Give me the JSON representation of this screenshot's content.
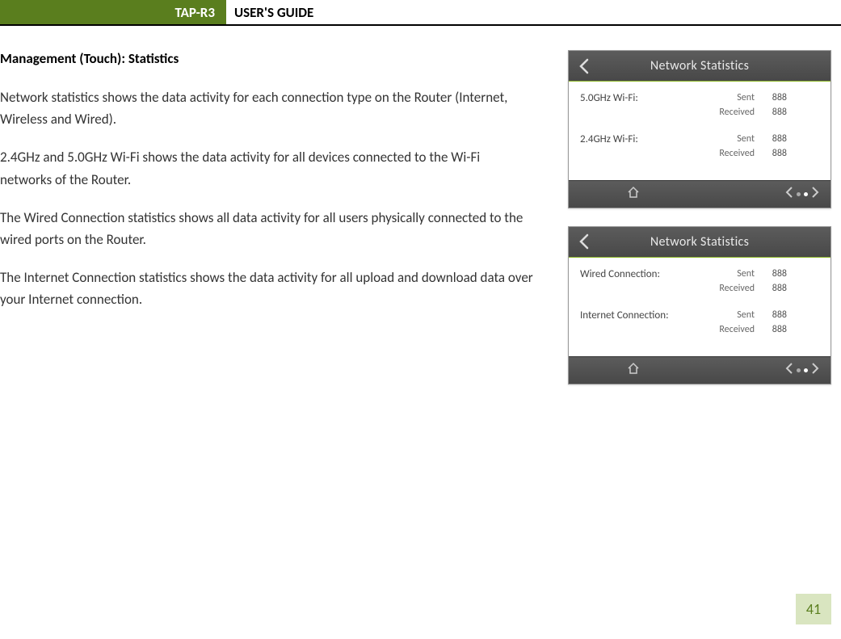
{
  "header": {
    "product": "TAP-R3",
    "guide": "USER'S GUIDE"
  },
  "section_title": "Management (Touch): Statistics",
  "paragraphs": {
    "p1": "Network statistics shows the data activity for each connection type on the Router (Internet, Wireless and Wired).",
    "p2": "2.4GHz and 5.0GHz Wi-Fi shows the data activity for all devices connected to the Wi-Fi networks of the Router.",
    "p3": "The Wired Connection statistics shows all data activity for all users physically connected to the wired ports on the Router.",
    "p4": "The Internet Connection statistics shows the data activity for all upload and download data over your Internet connection."
  },
  "screens": {
    "s1": {
      "title": "Network Statistics",
      "rows": {
        "r1": {
          "label": "5.0GHz Wi-Fi:",
          "sent_key": "Sent",
          "sent_val": "888",
          "recv_key": "Received",
          "recv_val": "888"
        },
        "r2": {
          "label": "2.4GHz Wi-Fi:",
          "sent_key": "Sent",
          "sent_val": "888",
          "recv_key": "Received",
          "recv_val": "888"
        }
      }
    },
    "s2": {
      "title": "Network Statistics",
      "rows": {
        "r1": {
          "label": "Wired Connection:",
          "sent_key": "Sent",
          "sent_val": "888",
          "recv_key": "Received",
          "recv_val": "888"
        },
        "r2": {
          "label": "Internet Connection:",
          "sent_key": "Sent",
          "sent_val": "888",
          "recv_key": "Received",
          "recv_val": "888"
        }
      }
    }
  },
  "page_number": "41"
}
